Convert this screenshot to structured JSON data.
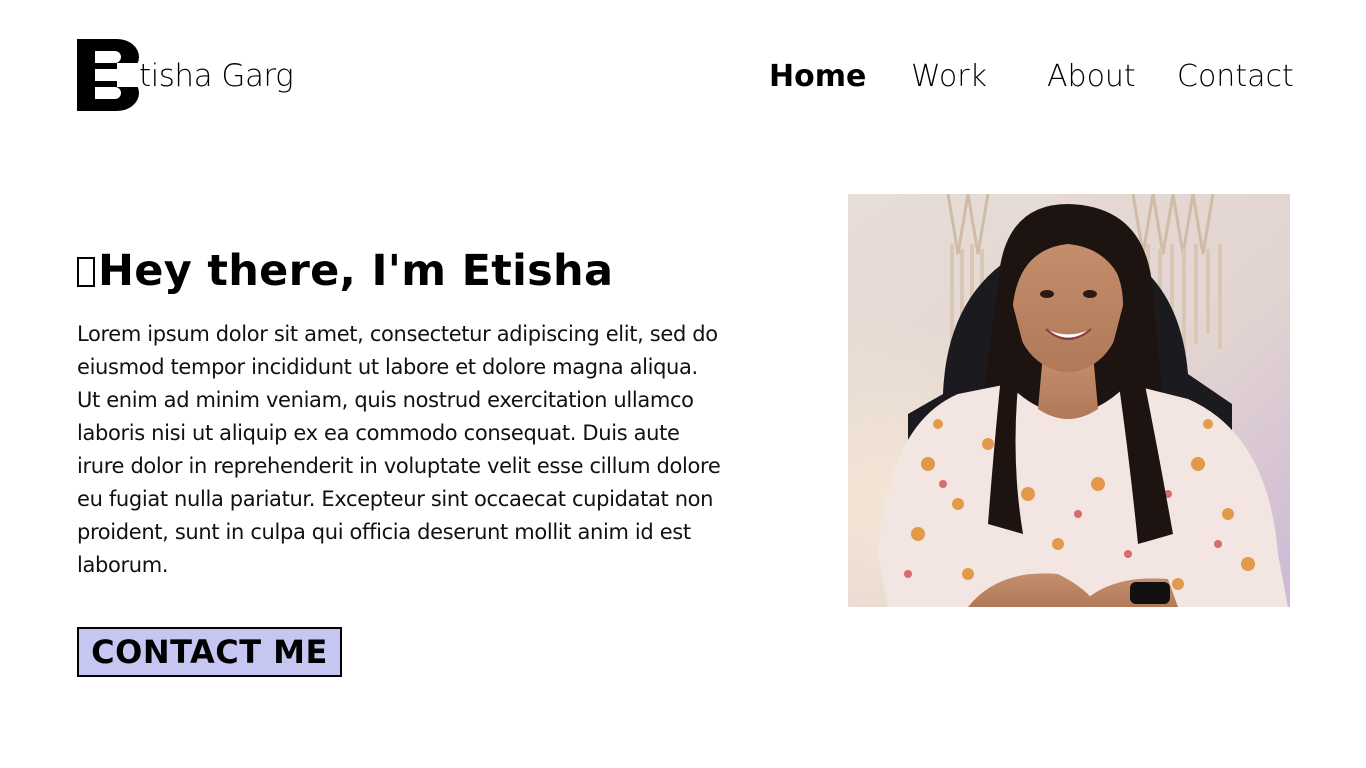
{
  "header": {
    "logo_mark_icon": "letter-e-logo-icon",
    "logo_text": "tisha Garg",
    "nav": [
      {
        "label": "Home",
        "active": true
      },
      {
        "label": "Work",
        "active": false
      },
      {
        "label": "About",
        "active": false
      },
      {
        "label": "Contact",
        "active": false
      }
    ]
  },
  "hero": {
    "title": "Hey there, I'm Etisha",
    "title_prefix_icon": "missing-glyph-box-icon",
    "body": "Lorem ipsum dolor sit amet, consectetur adipiscing elit, sed do eiusmod tempor incididunt ut labore et dolore magna aliqua. Ut enim ad minim veniam, quis nostrud exercitation ullamco laboris nisi ut aliquip ex ea commodo consequat. Duis aute irure dolor in reprehenderit in voluptate velit esse cillum dolore eu fugiat nulla pariatur. Excepteur sint occaecat cupidatat non proident, sunt in culpa qui officia deserunt mollit anim id est laborum.",
    "cta_label": "CONTACT ME"
  },
  "portrait": {
    "image_icon": "profile-photo"
  },
  "colors": {
    "background": "#ffffff",
    "text": "#000000",
    "cta_background": "#c6c6f2"
  }
}
